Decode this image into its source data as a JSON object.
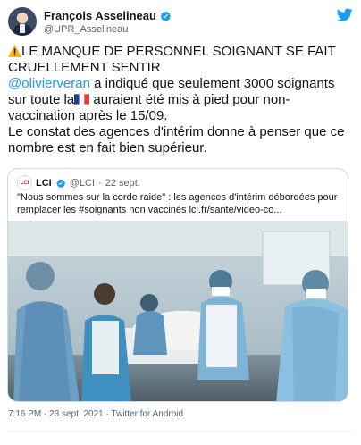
{
  "author": {
    "display_name": "François Asselineau",
    "handle": "@UPR_Asselineau",
    "verified_icon": "verified-badge-icon",
    "avatar_icon": "profile-photo"
  },
  "app_logo": "twitter-bird-icon",
  "tweet": {
    "line1": "LE MANQUE DE PERSONNEL SOIGNANT SE FAIT CRUELLEMENT SENTIR",
    "mention": "@olivierveran",
    "line2a": " a indiqué que seulement 3000 soignants sur toute la",
    "line2b": " auraient été mis à pied pour non-vaccination après le 15/09.",
    "line3": "Le constat des agences d'intérim  donne à penser que ce nombre est en fait bien supérieur."
  },
  "quoted_tweet": {
    "name": "LCI",
    "handle": "@LCI",
    "date": "22 sept.",
    "text": "\"Nous sommes sur la corde raide\" : les agences d'intérim débordées pour remplacer les #soignants non vaccinés lci.fr/sante/video-co...",
    "photo_description": "medical-staff-photo"
  },
  "footer": {
    "time": "7:16 PM",
    "date": "23 sept. 2021",
    "source": "Twitter for Android"
  },
  "colors": {
    "link": "#1d9bf0",
    "text": "#0f1419",
    "muted": "#536471",
    "border": "#cfd9de"
  }
}
